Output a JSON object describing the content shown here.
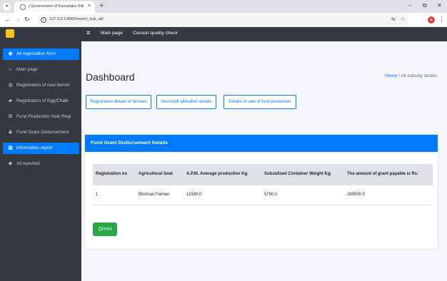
{
  "browser": {
    "tab_title": "| Government of Karnataka Silk",
    "tab_close": "×",
    "new_tab": "+",
    "url": "127.0.0.1:8000/report_sub_all/",
    "window_controls": {
      "minimize": "–",
      "restore": "⧉",
      "close": "✕"
    }
  },
  "navbar": {
    "links": [
      {
        "label": "Main page"
      },
      {
        "label": "Cocoon quality check"
      }
    ]
  },
  "sidebar": {
    "items": [
      {
        "label": "All registration form",
        "icon": "dashboard-icon",
        "glyph": "◉",
        "active": true
      },
      {
        "label": "Main page",
        "icon": "home-icon",
        "glyph": "⌂",
        "active": false
      },
      {
        "label": "Registration of new farmer",
        "icon": "user-circle-icon",
        "glyph": "◍",
        "active": false
      },
      {
        "label": "Registration of Egg/Chalk",
        "icon": "truck-icon",
        "glyph": "▰",
        "active": false
      },
      {
        "label": "Fund Production Sale Regi",
        "icon": "cart-icon",
        "glyph": "⊞",
        "active": false
      },
      {
        "label": "Fund Grant Disbursement",
        "icon": "user-icon",
        "glyph": "♟",
        "active": false
      },
      {
        "label": "Information report",
        "icon": "table-icon",
        "glyph": "▦",
        "active": true
      },
      {
        "label": "All reported",
        "icon": "tag-icon",
        "glyph": "◆",
        "active": false
      }
    ]
  },
  "page": {
    "title": "Dashboard",
    "breadcrumb": {
      "home": "Home",
      "separator": "/",
      "current": "All subsidy details"
    }
  },
  "actions": [
    {
      "label": "Registration details of farmers"
    },
    {
      "label": "Ovum/pill allocation details"
    },
    {
      "label": "Details of sale of fund production"
    }
  ],
  "card": {
    "header": "Fund Grant Disbursement Details",
    "columns": [
      "Registration no",
      "Agricultural boat",
      "A.P.M. Average production Kg.",
      "Subsidized Container Weight Kg.",
      "The amount of grant payable is Rs."
    ],
    "rows": [
      [
        "1",
        "Bhimrao Farmer",
        "11580.0",
        "5790.0",
        "289500.0"
      ]
    ],
    "print_label": "Print"
  },
  "colors": {
    "primary": "#007bff",
    "success": "#28a745",
    "sidebar": "#343a40"
  }
}
